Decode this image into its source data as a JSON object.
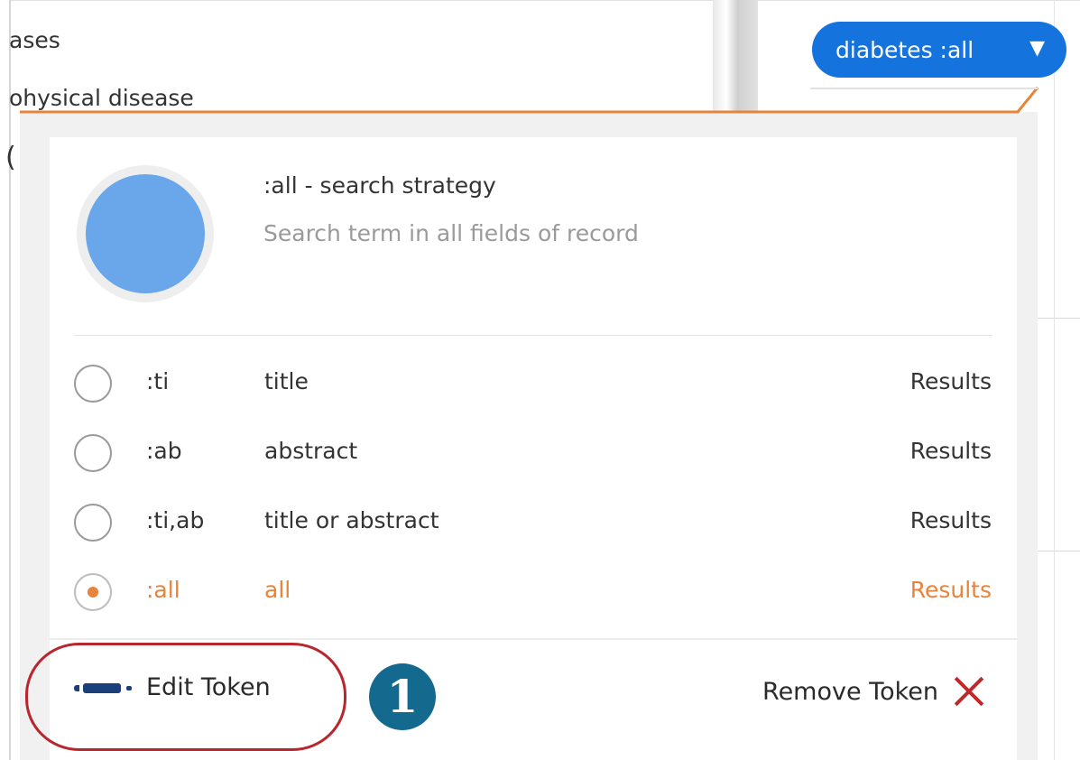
{
  "background": {
    "line1": "ases",
    "line2": "ohysical disease",
    "line3": "("
  },
  "token": {
    "label": "diabetes :all",
    "caret": "▼"
  },
  "strategy": {
    "title": ":all - search strategy",
    "description": "Search term in all fields of record"
  },
  "options": [
    {
      "code": ":ti",
      "label": "title",
      "results": "Results",
      "selected": false
    },
    {
      "code": ":ab",
      "label": "abstract",
      "results": "Results",
      "selected": false
    },
    {
      "code": ":ti,ab",
      "label": "title or abstract",
      "results": "Results",
      "selected": false
    },
    {
      "code": ":all",
      "label": "all",
      "results": "Results",
      "selected": true
    }
  ],
  "footer": {
    "edit_label": "Edit Token",
    "remove_label": "Remove Token"
  },
  "callout": {
    "number": "1"
  },
  "colors": {
    "token_blue": "#1573dd",
    "accent_orange": "#e8833a",
    "highlight_red": "#b8262e",
    "callout_teal": "#14698f"
  }
}
